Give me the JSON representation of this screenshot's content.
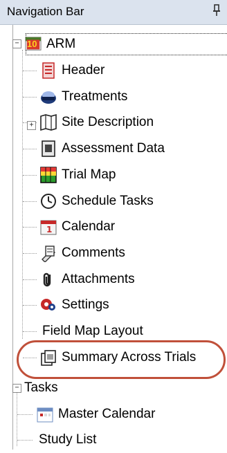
{
  "panel": {
    "title": "Navigation Bar"
  },
  "tree": {
    "root_arm": {
      "label": "ARM",
      "badge": "10"
    },
    "arm_children": [
      {
        "label": "Header",
        "icon": "header-icon"
      },
      {
        "label": "Treatments",
        "icon": "treatments-icon"
      },
      {
        "label": "Site Description",
        "icon": "site-description-icon"
      },
      {
        "label": "Assessment Data",
        "icon": "assessment-data-icon"
      },
      {
        "label": "Trial Map",
        "icon": "trial-map-icon"
      },
      {
        "label": "Schedule Tasks",
        "icon": "schedule-tasks-icon"
      },
      {
        "label": "Calendar",
        "icon": "calendar-icon"
      },
      {
        "label": "Comments",
        "icon": "comments-icon"
      },
      {
        "label": "Attachments",
        "icon": "attachments-icon"
      },
      {
        "label": "Settings",
        "icon": "settings-icon"
      },
      {
        "label": "Field Map Layout",
        "icon": ""
      },
      {
        "label": "Summary Across Trials",
        "icon": "summary-across-trials-icon"
      }
    ],
    "root_tasks": {
      "label": "Tasks"
    },
    "tasks_children": [
      {
        "label": "Master Calendar",
        "icon": "master-calendar-icon"
      },
      {
        "label": "Study List",
        "icon": ""
      }
    ]
  },
  "colors": {
    "titlebar": "#dbe3ee",
    "highlight": "#c0503a",
    "arm_badge_bg": "#d8392c"
  }
}
